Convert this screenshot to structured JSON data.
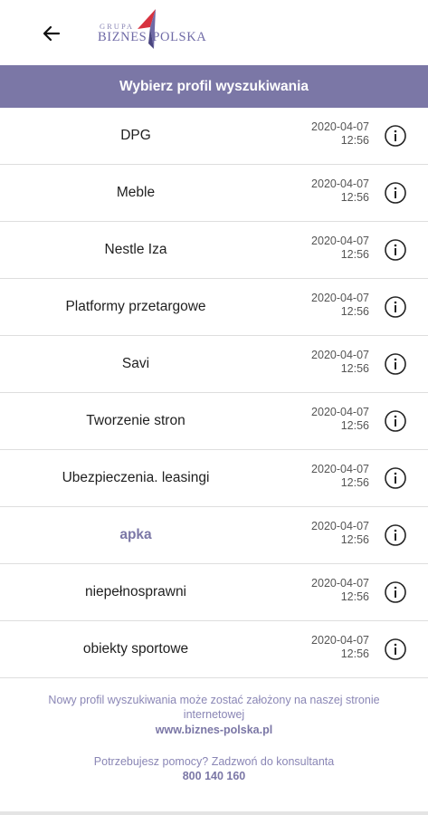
{
  "header": {
    "title": "Wybierz profil wyszukiwania"
  },
  "logo": {
    "top_text": "GRUPA",
    "left_text": "BIZNES",
    "right_text": "POLSKA"
  },
  "icons": {
    "back": "arrow-left-icon",
    "info": "info-circle-icon"
  },
  "colors": {
    "accent": "#7b77a6",
    "logo_red": "#d7323f"
  },
  "profiles": [
    {
      "name": "DPG",
      "date": "2020-04-07",
      "time": "12:56",
      "highlighted": false
    },
    {
      "name": "Meble",
      "date": "2020-04-07",
      "time": "12:56",
      "highlighted": false
    },
    {
      "name": "Nestle Iza",
      "date": "2020-04-07",
      "time": "12:56",
      "highlighted": false
    },
    {
      "name": "Platformy przetargowe",
      "date": "2020-04-07",
      "time": "12:56",
      "highlighted": false
    },
    {
      "name": "Savi",
      "date": "2020-04-07",
      "time": "12:56",
      "highlighted": false
    },
    {
      "name": "Tworzenie stron",
      "date": "2020-04-07",
      "time": "12:56",
      "highlighted": false
    },
    {
      "name": "Ubezpieczenia. leasingi",
      "date": "2020-04-07",
      "time": "12:56",
      "highlighted": false
    },
    {
      "name": "apka",
      "date": "2020-04-07",
      "time": "12:56",
      "highlighted": true
    },
    {
      "name": "niepełnosprawni",
      "date": "2020-04-07",
      "time": "12:56",
      "highlighted": false
    },
    {
      "name": "obiekty sportowe",
      "date": "2020-04-07",
      "time": "12:56",
      "highlighted": false
    }
  ],
  "footer": {
    "line1": "Nowy profil wyszukiwania może zostać założony na naszej stronie",
    "line2": "internetowej",
    "link": "www.biznes-polska.pl",
    "help": "Potrzebujesz pomocy? Zadzwoń do konsultanta",
    "phone": "800 140 160"
  }
}
